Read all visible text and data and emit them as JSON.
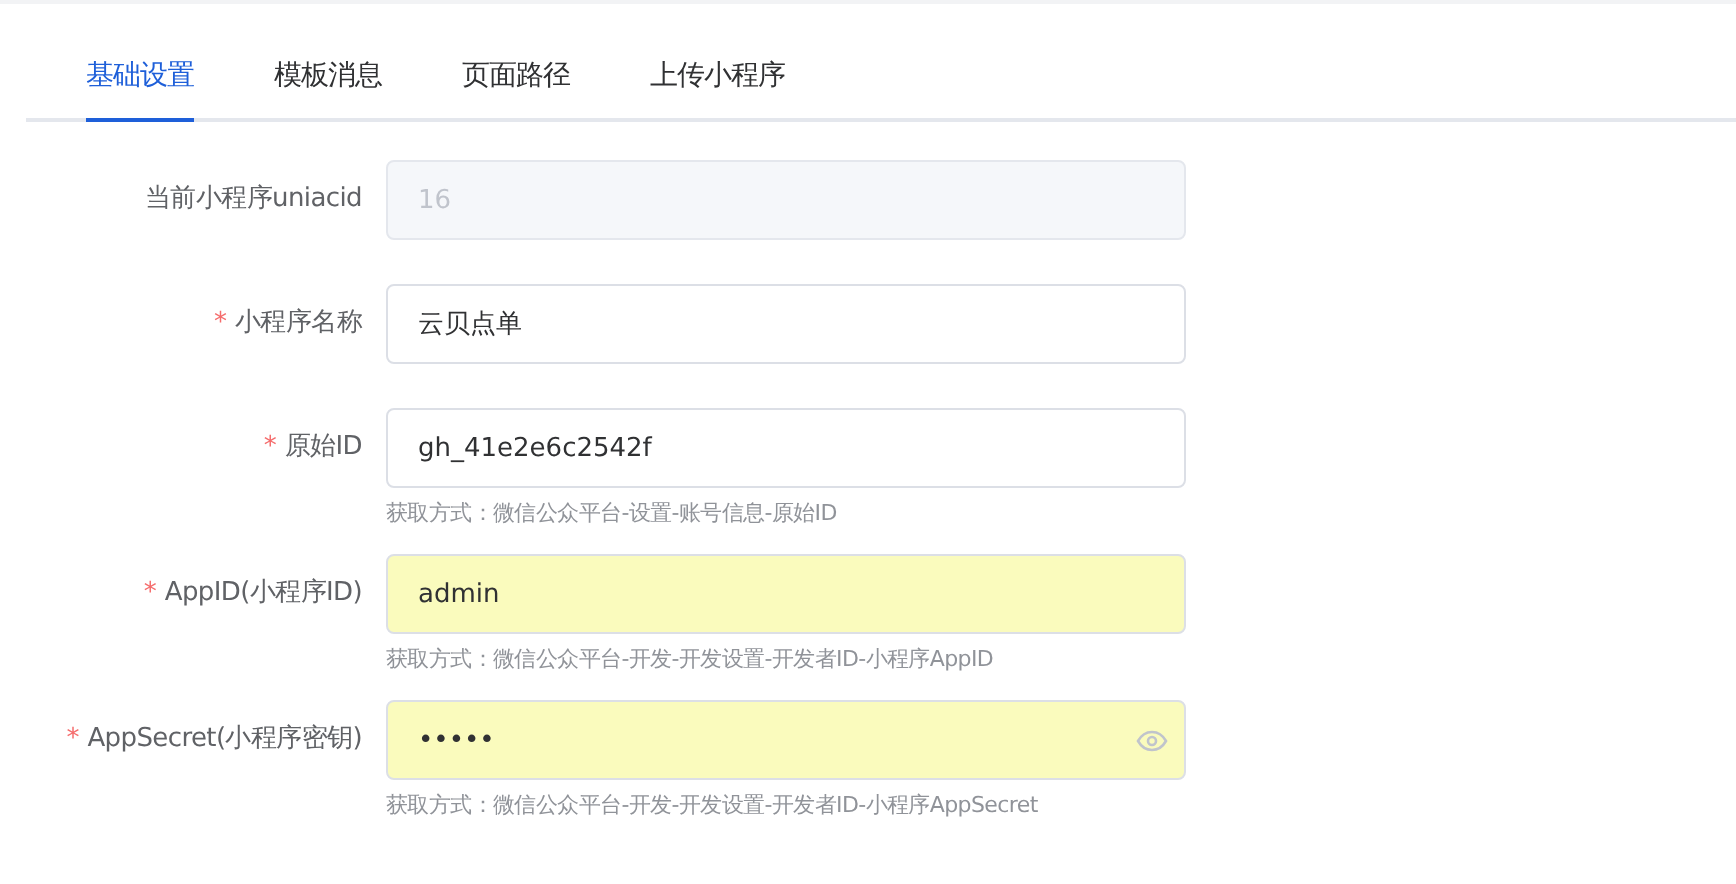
{
  "tabs": [
    {
      "label": "基础设置",
      "selected": true
    },
    {
      "label": "模板消息",
      "selected": false
    },
    {
      "label": "页面路径",
      "selected": false
    },
    {
      "label": "上传小程序",
      "selected": false
    }
  ],
  "fields": [
    {
      "kind": "text",
      "label": "当前小程序uniacid",
      "disabled": true,
      "autofilled": false,
      "value": "16"
    },
    {
      "kind": "text",
      "label": "小程序名称",
      "required_mark": "*",
      "disabled": false,
      "autofilled": false,
      "value": "云贝点单"
    },
    {
      "kind": "text",
      "label": "原始ID",
      "required_mark": "*",
      "disabled": false,
      "autofilled": false,
      "value": "gh_41e2e6c2542f",
      "hint": "获取方式：微信公众平台-设置-账号信息-原始ID"
    },
    {
      "kind": "text",
      "label": "AppID(小程序ID)",
      "required_mark": "*",
      "disabled": false,
      "autofilled": true,
      "value": "admin",
      "hint": "获取方式：微信公众平台-开发-开发设置-开发者ID-小程序AppID"
    },
    {
      "kind": "password",
      "label": "AppSecret(小程序密钥)",
      "required_mark": "*",
      "disabled": false,
      "autofilled": true,
      "value": "•••••",
      "hint": "获取方式：微信公众平台-开发-开发设置-开发者ID-小程序AppSecret"
    }
  ]
}
